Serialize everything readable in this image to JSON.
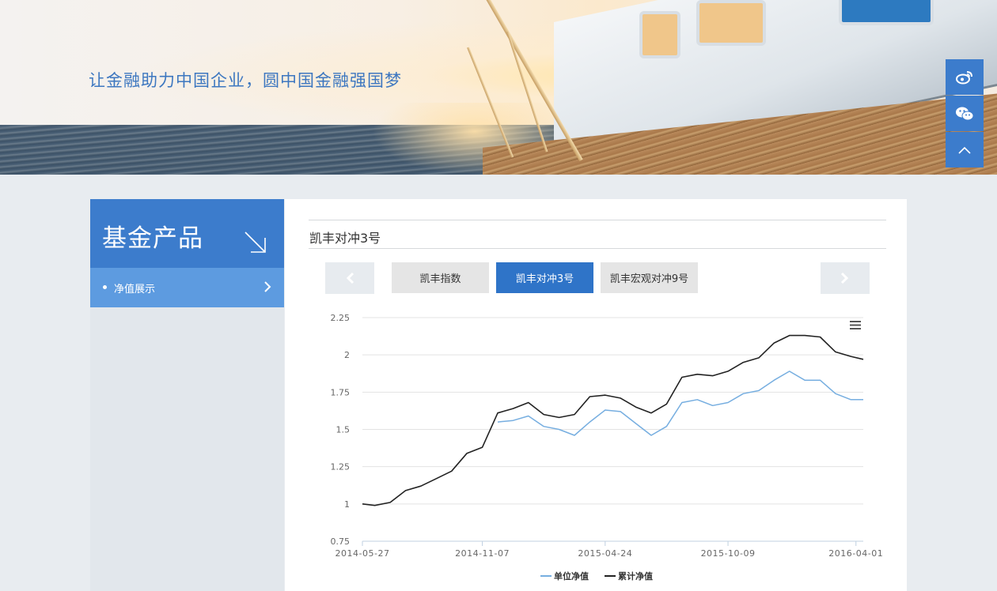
{
  "banner": {
    "slogan": "让金融助力中国企业，圆中国金融强国梦"
  },
  "side_tools": [
    "weibo-icon",
    "wechat-icon",
    "back-to-top-icon"
  ],
  "sidebar": {
    "title": "基金产品",
    "items": [
      {
        "label": "净值展示"
      }
    ]
  },
  "main": {
    "fund_title": "凯丰对冲3号",
    "tabs": [
      {
        "label": "凯丰指数",
        "active": false
      },
      {
        "label": "凯丰对冲3号",
        "active": true
      },
      {
        "label": "凯丰宏观对冲9号",
        "active": false
      }
    ]
  },
  "colors": {
    "accent": "#3c7ccc",
    "active_tab": "#2f74c8",
    "series_unit": "#76aee0",
    "series_cumulative": "#222222"
  },
  "chart_data": {
    "type": "line",
    "x_ticks": [
      "2014-05-27",
      "2014-11-07",
      "2015-04-24",
      "2015-10-09",
      "2016-04-01"
    ],
    "y_ticks": [
      "0.75",
      "1",
      "1.25",
      "1.5",
      "1.75",
      "2",
      "2.25"
    ],
    "ylim": [
      0.75,
      2.25
    ],
    "xlim": [
      "2014-05-27",
      "2016-04-11"
    ],
    "grid": true,
    "legend": "bottom-center",
    "x": [
      "2014-05-27",
      "2014-06-13",
      "2014-07-04",
      "2014-07-25",
      "2014-08-15",
      "2014-09-05",
      "2014-09-26",
      "2014-10-17",
      "2014-11-07",
      "2014-11-28",
      "2014-12-19",
      "2015-01-09",
      "2015-01-30",
      "2015-02-20",
      "2015-03-13",
      "2015-04-03",
      "2015-04-24",
      "2015-05-15",
      "2015-06-05",
      "2015-06-26",
      "2015-07-17",
      "2015-08-07",
      "2015-08-28",
      "2015-09-18",
      "2015-10-09",
      "2015-10-30",
      "2015-11-20",
      "2015-12-11",
      "2016-01-01",
      "2016-01-22",
      "2016-02-12",
      "2016-03-04",
      "2016-03-25",
      "2016-04-11"
    ],
    "series": [
      {
        "name": "单位净值",
        "values": [
          null,
          null,
          null,
          null,
          null,
          null,
          null,
          null,
          null,
          1.55,
          1.56,
          1.59,
          1.52,
          1.5,
          1.46,
          1.55,
          1.63,
          1.62,
          1.54,
          1.46,
          1.52,
          1.68,
          1.7,
          1.66,
          1.68,
          1.74,
          1.76,
          1.83,
          1.89,
          1.83,
          1.83,
          1.74,
          1.7,
          1.7
        ]
      },
      {
        "name": "累计净值",
        "values": [
          1.0,
          0.99,
          1.01,
          1.09,
          1.12,
          1.17,
          1.22,
          1.34,
          1.38,
          1.61,
          1.64,
          1.68,
          1.6,
          1.58,
          1.6,
          1.72,
          1.73,
          1.71,
          1.65,
          1.61,
          1.67,
          1.85,
          1.87,
          1.86,
          1.89,
          1.95,
          1.98,
          2.08,
          2.13,
          2.13,
          2.12,
          2.02,
          1.99,
          1.97
        ]
      }
    ]
  }
}
